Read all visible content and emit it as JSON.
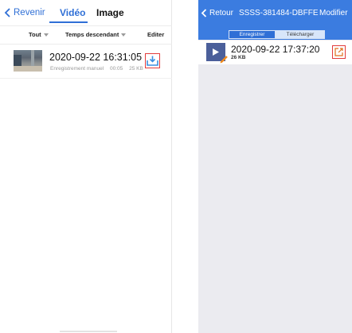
{
  "left": {
    "nav": {
      "back_label": "Revenir",
      "tab_video": "Vidéo",
      "tab_image": "Image"
    },
    "filter": {
      "all_label": "Tout",
      "sort_label": "Temps descendant",
      "edit_label": "Editer"
    },
    "record": {
      "datetime": "2020-09-22  16:31:05",
      "type": "Enregistrement manuel",
      "duration": "00:05",
      "size": "25 KB"
    },
    "icons": {
      "back": "chevron-left-icon",
      "download": "download-tray-icon",
      "dropdown": "triangle-down-icon"
    },
    "colors": {
      "accent": "#2f6fd6",
      "highlight_box": "#e23b3b"
    }
  },
  "right": {
    "nav": {
      "back_label": "Retour",
      "title": "SSSS-381484-DBFFE",
      "modify_label": "Modifier"
    },
    "segment": {
      "record_label": "Enregistrer",
      "download_label": "Télécharger"
    },
    "record": {
      "datetime": "2020-09-22  17:37:20",
      "size": "26 KB"
    },
    "icons": {
      "back": "chevron-left-icon",
      "play": "play-icon",
      "edit": "pencil-icon",
      "share": "share-icon"
    },
    "colors": {
      "nav_bg": "#3b7ce0",
      "page_bg": "#ebebf0",
      "highlight_box": "#e23b3b"
    }
  }
}
